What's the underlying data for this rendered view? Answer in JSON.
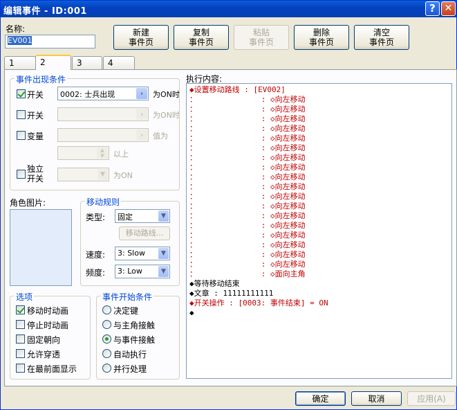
{
  "window": {
    "title": "编辑事件 - ID:001",
    "help": "?",
    "close": "✕"
  },
  "name": {
    "label": "名称:",
    "value": "EV001"
  },
  "toolbar": {
    "new_page": "新建\n事件页",
    "copy_page": "复制\n事件页",
    "paste_page": "粘贴\n事件页",
    "delete_page": "删除\n事件页",
    "clear_page": "清空\n事件页"
  },
  "tabs": [
    "1",
    "2",
    "3",
    "4"
  ],
  "active_tab": "2",
  "conditions": {
    "title": "事件出现条件",
    "switch1": {
      "label": "开关",
      "checked": true,
      "value": "0002: 士兵出现",
      "suffix": "为ON时"
    },
    "switch2": {
      "label": "开关",
      "checked": false,
      "suffix": "为ON时"
    },
    "variable": {
      "label": "变量",
      "checked": false,
      "suffix": "值为",
      "suffix2": "以上"
    },
    "self_switch": {
      "label": "独立\n开关",
      "checked": false,
      "suffix": "为ON"
    }
  },
  "graphic": {
    "label": "角色图片:"
  },
  "move_rule": {
    "title": "移动规则",
    "type_label": "类型:",
    "type_value": "固定",
    "route_button": "移动路线...",
    "speed_label": "速度:",
    "speed_value": "3: Slow",
    "freq_label": "频度:",
    "freq_value": "3: Low"
  },
  "options": {
    "title": "选项",
    "items": [
      {
        "label": "移动时动画",
        "checked": true
      },
      {
        "label": "停止时动画",
        "checked": false
      },
      {
        "label": "固定朝向",
        "checked": false
      },
      {
        "label": "允许穿透",
        "checked": false
      },
      {
        "label": "在最前面显示",
        "checked": false
      }
    ]
  },
  "trigger": {
    "title": "事件开始条件",
    "items": [
      {
        "label": "决定键",
        "checked": false
      },
      {
        "label": "与主角接触",
        "checked": false
      },
      {
        "label": "与事件接触",
        "checked": true
      },
      {
        "label": "自动执行",
        "checked": false
      },
      {
        "label": "并行处理",
        "checked": false
      }
    ]
  },
  "content": {
    "label": "执行内容:",
    "lines": [
      {
        "text": "◆设置移动路线 : [EV002]",
        "color": "#c00000"
      },
      {
        "text": "：              : ◇向左移动",
        "color": "#c00000"
      },
      {
        "text": "：              : ◇向左移动",
        "color": "#c00000"
      },
      {
        "text": "：              : ◇向左移动",
        "color": "#c00000"
      },
      {
        "text": "：              : ◇向左移动",
        "color": "#c00000"
      },
      {
        "text": "：              : ◇向左移动",
        "color": "#c00000"
      },
      {
        "text": "：              : ◇向左移动",
        "color": "#c00000"
      },
      {
        "text": "：              : ◇向左移动",
        "color": "#c00000"
      },
      {
        "text": "：              : ◇向左移动",
        "color": "#c00000"
      },
      {
        "text": "：              : ◇向左移动",
        "color": "#c00000"
      },
      {
        "text": "：              : ◇向左移动",
        "color": "#c00000"
      },
      {
        "text": "：              : ◇向左移动",
        "color": "#c00000"
      },
      {
        "text": "：              : ◇向左移动",
        "color": "#c00000"
      },
      {
        "text": "：              : ◇向左移动",
        "color": "#c00000"
      },
      {
        "text": "：              : ◇向左移动",
        "color": "#c00000"
      },
      {
        "text": "：              : ◇向左移动",
        "color": "#c00000"
      },
      {
        "text": "：              : ◇向左移动",
        "color": "#c00000"
      },
      {
        "text": "：              : ◇向左移动",
        "color": "#c00000"
      },
      {
        "text": "：              : ◇向左移动",
        "color": "#c00000"
      },
      {
        "text": "：              : ◇面向主角",
        "color": "#c00000"
      },
      {
        "text": "◆等待移动结束",
        "color": "#000000"
      },
      {
        "text": "◆文章 : 11111111111",
        "color": "#000000"
      },
      {
        "text": "◆开关操作 : [0003: 事件结束] = ON",
        "color": "#c00000"
      },
      {
        "text": "◆",
        "color": "#000000"
      }
    ]
  },
  "footer": {
    "ok": "确定",
    "cancel": "取消",
    "apply": "应用(A)"
  }
}
